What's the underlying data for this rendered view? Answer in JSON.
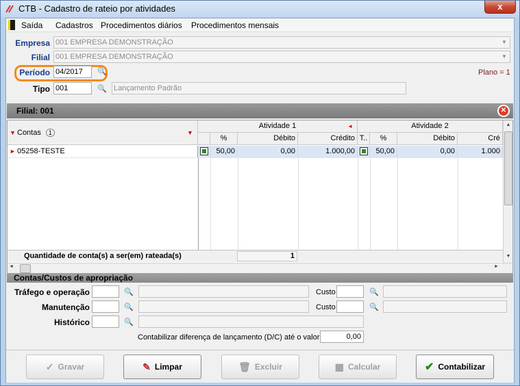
{
  "window": {
    "title": "CTB - Cadastro de rateio por atividades",
    "close_label": "x"
  },
  "menu": {
    "items": [
      "Saída",
      "Cadastros",
      "Procedimentos diários",
      "Procedimentos mensais"
    ]
  },
  "form": {
    "empresa": {
      "label": "Empresa",
      "value": "001 EMPRESA DEMONSTRAÇÃO"
    },
    "filial": {
      "label": "Filial",
      "value": "001 EMPRESA DEMONSTRAÇÃO"
    },
    "periodo": {
      "label": "Período",
      "value": "04/2017"
    },
    "tipo": {
      "label": "Tipo",
      "value": "001",
      "description": "Lançamento Padrão"
    },
    "plano": "Plano = 1"
  },
  "panel": {
    "title": "Filial: 001"
  },
  "grid": {
    "contas_header": "Contas",
    "sort_badge": "1",
    "groups": [
      "Atividade 1",
      "Atividade 2"
    ],
    "columns_a1": [
      "%",
      "Débito",
      "Crédito"
    ],
    "columns_a2": [
      "T..",
      "%",
      "Débito",
      "Cré"
    ],
    "rows": [
      {
        "conta": "05258-TESTE",
        "a1_pct": "50,00",
        "a1_debito": "0,00",
        "a1_credito": "1.000,00",
        "a2_pct": "50,00",
        "a2_debito": "0,00",
        "a2_credito": "1.000"
      }
    ],
    "footer_label": "Quantidade de conta(s) a ser(em) rateada(s)",
    "footer_value": "1"
  },
  "apropriacao": {
    "title": "Contas/Custos de apropriação",
    "trafego_label": "Tráfego e operação",
    "manutencao_label": "Manutenção",
    "historico_label": "Histórico",
    "custo_label": "Custo",
    "contabilizar_label": "Contabilizar diferença de lançamento (D/C) até o valor:",
    "contabilizar_value": "0,00"
  },
  "buttons": {
    "gravar": "Gravar",
    "limpar": "Limpar",
    "excluir": "Excluir",
    "calcular": "Calcular",
    "contabilizar": "Contabilizar"
  }
}
